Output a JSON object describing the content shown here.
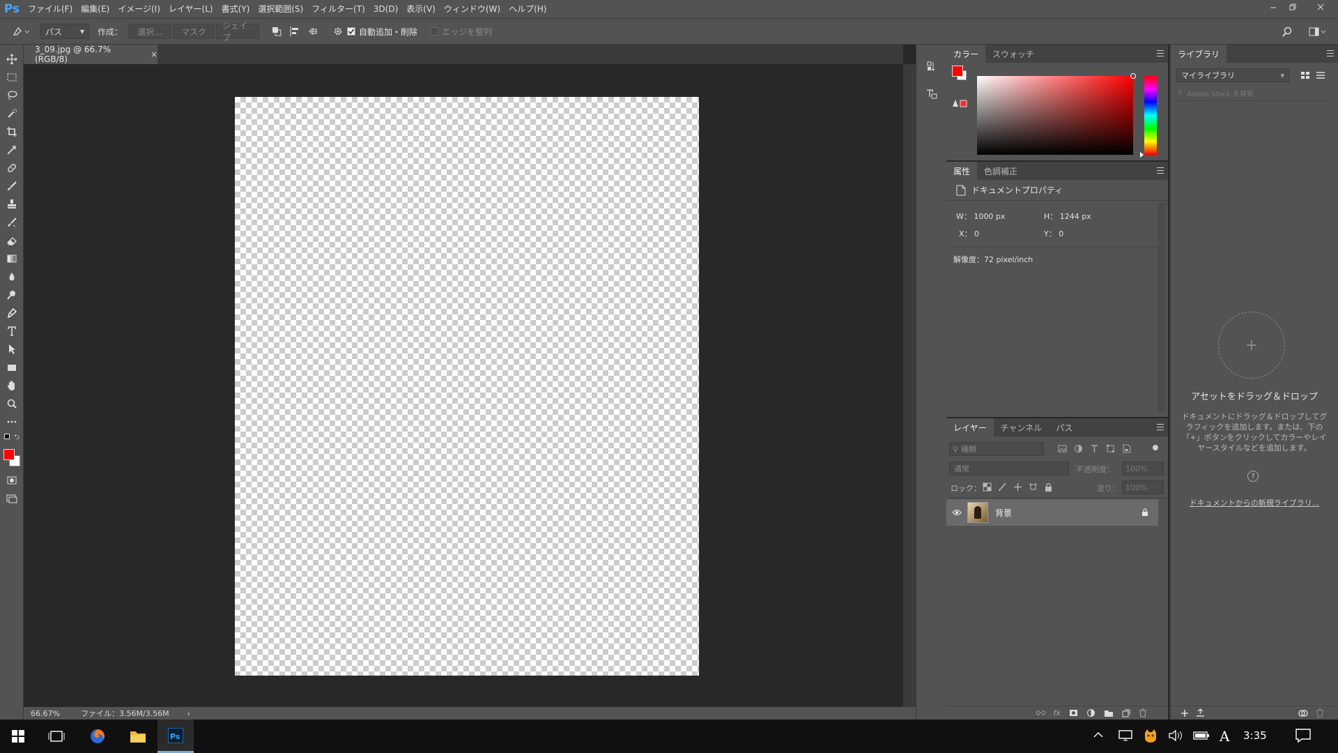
{
  "app": {
    "logo": "Ps"
  },
  "menu": [
    "ファイル(F)",
    "編集(E)",
    "イメージ(I)",
    "レイヤー(L)",
    "書式(Y)",
    "選択範囲(S)",
    "フィルター(T)",
    "3D(D)",
    "表示(V)",
    "ウィンドウ(W)",
    "ヘルプ(H)"
  ],
  "options": {
    "mode_value": "パス",
    "create_label": "作成：",
    "btn_select": "選択...",
    "btn_mask": "マスク",
    "btn_shape": "シェイプ",
    "auto_add_label": "自動追加・削除",
    "auto_add_checked": true,
    "align_edges_label": "エッジを整列",
    "align_edges_checked": false
  },
  "document": {
    "tab_title": "3_09.jpg @ 66.7% (RGB/8)",
    "tab_close": "×",
    "zoom": "66.67%",
    "file_info": "ファイル：3.56M/3.56M",
    "status_arrow": "›"
  },
  "color_panel": {
    "tabs": [
      "カラー",
      "スウォッチ"
    ],
    "foreground": "#ff0000",
    "background": "#ffffff"
  },
  "properties_panel": {
    "tabs": [
      "属性",
      "色調補正"
    ],
    "heading": "ドキュメントプロパティ",
    "w_label": "W：",
    "w_value": "1000 px",
    "h_label": "H：",
    "h_value": "1244 px",
    "x_label": "X：",
    "x_value": "0",
    "y_label": "Y：",
    "y_value": "0",
    "resolution": "解像度：72 pixel/inch"
  },
  "layers_panel": {
    "tabs": [
      "レイヤー",
      "チャンネル",
      "パス"
    ],
    "filter_placeholder": "種類",
    "blend_mode": "通常",
    "opacity_label": "不透明度：",
    "opacity_value": "100%",
    "lock_label": "ロック：",
    "fill_label": "塗り：",
    "fill_value": "100%",
    "layers": [
      {
        "name": "背景",
        "visible": true,
        "locked": true
      }
    ]
  },
  "library_panel": {
    "tab": "ライブラリ",
    "library_name": "マイライブラリ",
    "search_placeholder": "Adobe Stock を検索",
    "drop_title": "アセットをドラッグ＆ドロップ",
    "drop_desc": "ドキュメントにドラッグ＆ドロップしてグラフィックを追加します。または、下の「+」ボタンをクリックしてカラーやレイヤースタイルなどを追加します。",
    "new_from_doc_link": "ドキュメントからの新規ライブラリ..."
  },
  "taskbar": {
    "time": "3:35",
    "ime": "A"
  },
  "colors": {
    "accent": "#4aa3ff",
    "panel_bg": "#535353",
    "canvas_bg": "#282828"
  }
}
